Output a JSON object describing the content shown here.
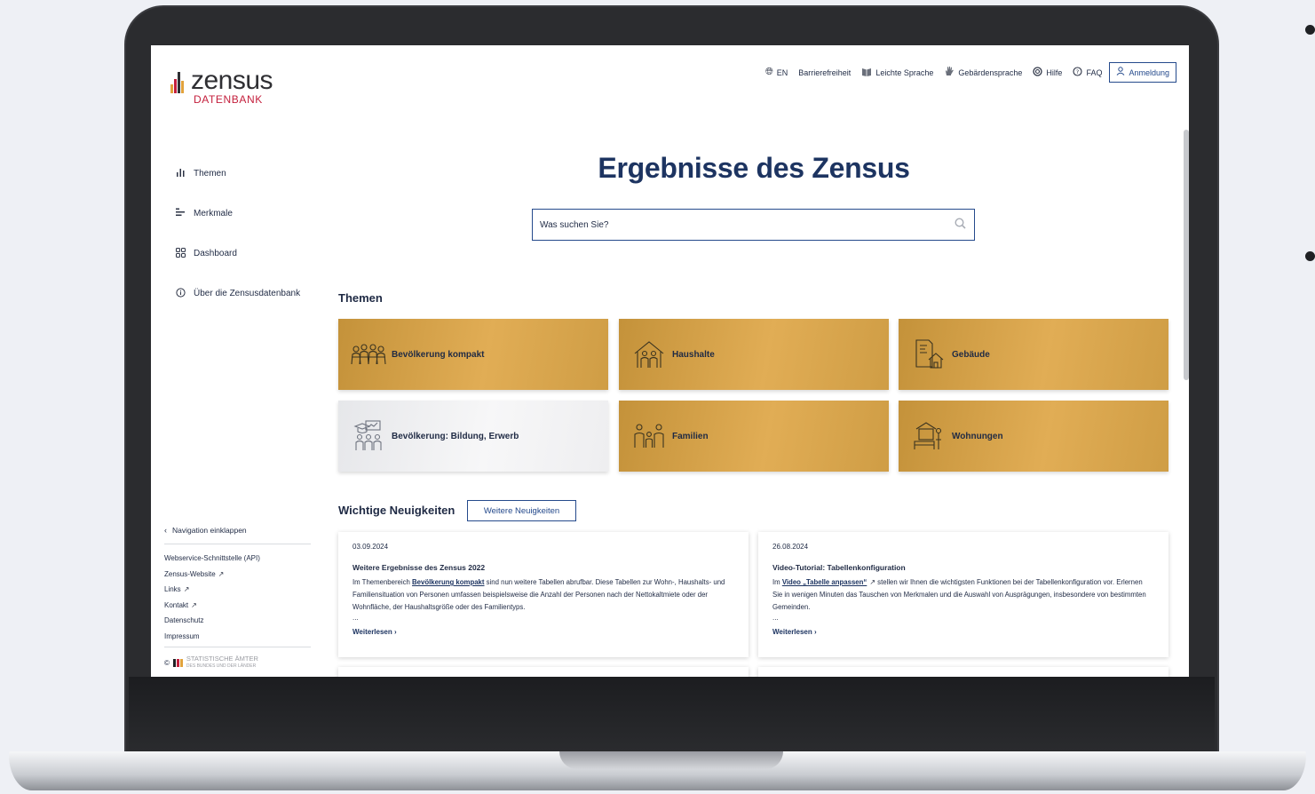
{
  "logo": {
    "name": "zensus",
    "sub": "DATENBANK"
  },
  "topnav": {
    "language": "EN",
    "accessibility": "Barrierefreiheit",
    "easy_language": "Leichte Sprache",
    "sign_language": "Gebärdensprache",
    "help": "Hilfe",
    "faq": "FAQ",
    "login": "Anmeldung"
  },
  "sidebar": {
    "items": [
      {
        "label": "Themen",
        "icon": "bar-chart-icon"
      },
      {
        "label": "Merkmale",
        "icon": "list-bars-icon"
      },
      {
        "label": "Dashboard",
        "icon": "grid-icon"
      },
      {
        "label": "Über die Zensusdatenbank",
        "icon": "info-icon"
      }
    ],
    "collapse": "Navigation einklappen",
    "links": [
      {
        "label": "Webservice-Schnittstelle (API)",
        "external": false
      },
      {
        "label": "Zensus-Website",
        "external": true
      },
      {
        "label": "Links",
        "external": true
      },
      {
        "label": "Kontakt",
        "external": true
      },
      {
        "label": "Datenschutz",
        "external": false
      },
      {
        "label": "Impressum",
        "external": false
      }
    ],
    "copyright": "©",
    "statistics_offices": "STATISTISCHE ÄMTER",
    "statistics_offices_sub": "DES BUNDES UND DER LÄNDER"
  },
  "main": {
    "headline": "Ergebnisse des Zensus",
    "search_placeholder": "Was suchen Sie?",
    "themes_title": "Themen",
    "themes": [
      {
        "label": "Bevölkerung kompakt",
        "icon": "people-group-icon",
        "style": "gold"
      },
      {
        "label": "Haushalte",
        "icon": "household-icon",
        "style": "gold"
      },
      {
        "label": "Gebäude",
        "icon": "building-icon",
        "style": "gold"
      },
      {
        "label": "Bevölkerung: Bildung, Erwerb",
        "icon": "education-icon",
        "style": "grey"
      },
      {
        "label": "Familien",
        "icon": "family-icon",
        "style": "gold"
      },
      {
        "label": "Wohnungen",
        "icon": "apartment-icon",
        "style": "gold"
      }
    ],
    "news_title": "Wichtige Neuigkeiten",
    "more_news": "Weitere Neuigkeiten",
    "news": [
      {
        "date": "03.09.2024",
        "title": "Weitere Ergebnisse des Zensus 2022",
        "text_before": "Im Themenbereich ",
        "link": "Bevölkerung kompakt",
        "text_after": " sind nun weitere Tabellen abrufbar. Diese Tabellen zur Wohn-, Haushalts- und Familiensituation von Personen umfassen beispielsweise die Anzahl der Personen nach der Nettokaltmiete oder der Wohnfläche, der Haushaltsgröße oder des Familientyps.",
        "ellipsis": "...",
        "read_more": "Weiterlesen ›"
      },
      {
        "date": "26.08.2024",
        "title": "Video-Tutorial: Tabellenkonfiguration",
        "text_before": "Im ",
        "link": "Video „Tabelle anpassen“",
        "text_after": " stellen wir Ihnen die wichtigsten Funktionen bei der Tabellenkonfiguration vor. Erlernen Sie in wenigen Minuten das Tauschen von Merkmalen und die Auswahl von Ausprägungen, insbesondere von bestimmten Gemeinden.",
        "ellipsis": "...",
        "read_more": "Weiterlesen ›"
      }
    ]
  },
  "colors": {
    "primary": "#1d3461",
    "accent_red": "#c4203d",
    "tile_gold": "#e1ad55",
    "tile_grey": "#f0f0f2"
  }
}
